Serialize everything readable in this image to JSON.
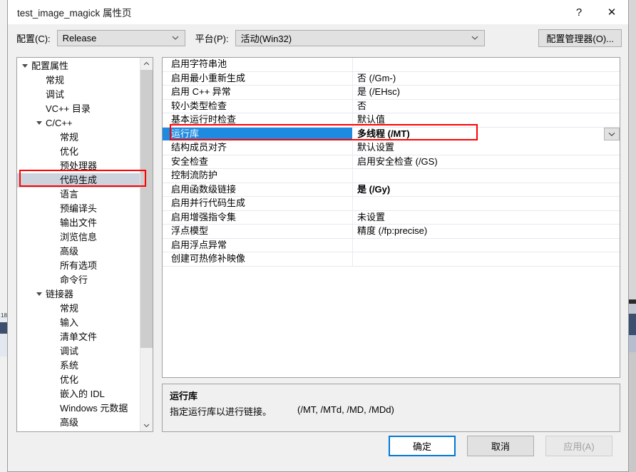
{
  "window": {
    "title": "test_image_magick 属性页",
    "help_button": "?",
    "close_button": "✕"
  },
  "configbar": {
    "config_label": "配置(C):",
    "config_value": "Release",
    "platform_label": "平台(P):",
    "platform_value": "活动(Win32)",
    "config_manager_button": "配置管理器(O)..."
  },
  "tree": {
    "items": [
      {
        "label": "配置属性",
        "indent": 20,
        "arrow": "down",
        "selected": false
      },
      {
        "label": "常规",
        "indent": 40,
        "arrow": "none",
        "selected": false
      },
      {
        "label": "调试",
        "indent": 40,
        "arrow": "none",
        "selected": false
      },
      {
        "label": "VC++ 目录",
        "indent": 40,
        "arrow": "none",
        "selected": false
      },
      {
        "label": "C/C++",
        "indent": 40,
        "arrow": "down",
        "selected": false
      },
      {
        "label": "常规",
        "indent": 60,
        "arrow": "none",
        "selected": false
      },
      {
        "label": "优化",
        "indent": 60,
        "arrow": "none",
        "selected": false
      },
      {
        "label": "预处理器",
        "indent": 60,
        "arrow": "none",
        "selected": false
      },
      {
        "label": "代码生成",
        "indent": 60,
        "arrow": "none",
        "selected": true
      },
      {
        "label": "语言",
        "indent": 60,
        "arrow": "none",
        "selected": false
      },
      {
        "label": "预编译头",
        "indent": 60,
        "arrow": "none",
        "selected": false
      },
      {
        "label": "输出文件",
        "indent": 60,
        "arrow": "none",
        "selected": false
      },
      {
        "label": "浏览信息",
        "indent": 60,
        "arrow": "none",
        "selected": false
      },
      {
        "label": "高级",
        "indent": 60,
        "arrow": "none",
        "selected": false
      },
      {
        "label": "所有选项",
        "indent": 60,
        "arrow": "none",
        "selected": false
      },
      {
        "label": "命令行",
        "indent": 60,
        "arrow": "none",
        "selected": false
      },
      {
        "label": "链接器",
        "indent": 40,
        "arrow": "down",
        "selected": false
      },
      {
        "label": "常规",
        "indent": 60,
        "arrow": "none",
        "selected": false
      },
      {
        "label": "输入",
        "indent": 60,
        "arrow": "none",
        "selected": false
      },
      {
        "label": "清单文件",
        "indent": 60,
        "arrow": "none",
        "selected": false
      },
      {
        "label": "调试",
        "indent": 60,
        "arrow": "none",
        "selected": false
      },
      {
        "label": "系统",
        "indent": 60,
        "arrow": "none",
        "selected": false
      },
      {
        "label": "优化",
        "indent": 60,
        "arrow": "none",
        "selected": false
      },
      {
        "label": "嵌入的 IDL",
        "indent": 60,
        "arrow": "none",
        "selected": false
      },
      {
        "label": "Windows 元数据",
        "indent": 60,
        "arrow": "none",
        "selected": false
      },
      {
        "label": "高级",
        "indent": 60,
        "arrow": "none",
        "selected": false
      }
    ]
  },
  "grid": {
    "rows": [
      {
        "name": "启用字符串池",
        "value": "",
        "bold": false,
        "selected": false
      },
      {
        "name": "启用最小重新生成",
        "value": "否 (/Gm-)",
        "bold": false,
        "selected": false
      },
      {
        "name": "启用 C++ 异常",
        "value": "是 (/EHsc)",
        "bold": false,
        "selected": false
      },
      {
        "name": "较小类型检查",
        "value": "否",
        "bold": false,
        "selected": false
      },
      {
        "name": "基本运行时检查",
        "value": "默认值",
        "bold": false,
        "selected": false
      },
      {
        "name": "运行库",
        "value": "多线程 (/MT)",
        "bold": true,
        "selected": true
      },
      {
        "name": "结构成员对齐",
        "value": "默认设置",
        "bold": false,
        "selected": false
      },
      {
        "name": "安全检查",
        "value": "启用安全检查 (/GS)",
        "bold": false,
        "selected": false
      },
      {
        "name": "控制流防护",
        "value": "",
        "bold": false,
        "selected": false
      },
      {
        "name": "启用函数级链接",
        "value": "是 (/Gy)",
        "bold": true,
        "selected": false
      },
      {
        "name": "启用并行代码生成",
        "value": "",
        "bold": false,
        "selected": false
      },
      {
        "name": "启用增强指令集",
        "value": "未设置",
        "bold": false,
        "selected": false
      },
      {
        "name": "浮点模型",
        "value": "精度 (/fp:precise)",
        "bold": false,
        "selected": false
      },
      {
        "name": "启用浮点异常",
        "value": "",
        "bold": false,
        "selected": false
      },
      {
        "name": "创建可热修补映像",
        "value": "",
        "bold": false,
        "selected": false
      }
    ]
  },
  "description": {
    "title": "运行库",
    "text": "指定运行库以进行链接。",
    "flags": "(/MT, /MTd, /MD, /MDd)"
  },
  "footer": {
    "ok": "确定",
    "cancel": "取消",
    "apply": "应用(A)"
  },
  "background": {
    "left_text": "18"
  },
  "colors": {
    "selection_blue": "#1e8ae0",
    "tree_selection": "#cdd3dd",
    "annotation_red": "#ff0000",
    "default_button_border": "#0078d7",
    "dialog_bg": "#f0f0f0"
  }
}
